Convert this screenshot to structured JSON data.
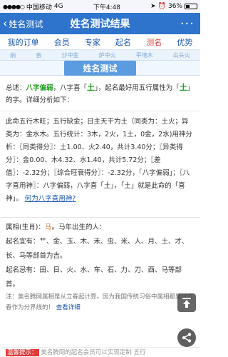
{
  "status": {
    "carrier": "中国移动",
    "network": "4G",
    "time": "下午4:48",
    "battery": "36%"
  },
  "nav": {
    "back_label": "姓名测试",
    "title": "姓名测试结果",
    "more_label": "···"
  },
  "tabs": [
    {
      "label": "我的订单"
    },
    {
      "label": "会员"
    },
    {
      "label": "专家"
    },
    {
      "label": "起名"
    },
    {
      "label": "测名"
    },
    {
      "label": "优势"
    }
  ],
  "wuxing_strip": [
    "纳",
    "音",
    "沙中金",
    "炉中火",
    "平地木",
    "山头火"
  ],
  "banner": "姓名测试",
  "summary": {
    "prefix": "总述：",
    "p1": "八字偏弱",
    "p2": "，八字喜「",
    "p3": "土",
    "p4": "」，起名最好用五行属性为「",
    "p5": "土",
    "p6": "」的字。详细分析如下："
  },
  "analysis": {
    "text": "此命五行木旺；五行缺金；日主天干为土（同类为：土火；异类为：金水木。五行统计：3木，2火，1土，0金，2水)用神分析：〖同类得分〗：土1.00、火2.40，共计3.40分；〖异类得分〗：金0.00、木4.32、水1.40，共计5.72分；〖差值〗：-2.32分；〖综合旺衰得分〗：-2.32分，「八字偏弱」；〖八字喜用神〗：八字偏弱，八字喜「土」，「土」就是此命的「喜神」。",
    "link": "何为八字喜用神?"
  },
  "zodiac": {
    "title_prefix": "属相(生肖)：",
    "animal": "马",
    "title_suffix": "。马年出生的人：",
    "good_label": "起名宜有：",
    "good": "艹、金、玉、木、禾、虫、米、人、月、土、才、长、马等部首为吉。",
    "bad_label": "起名忌有：",
    "bad": "田、日、火、水、车、石、力、刀、酉、马等部首。",
    "note": "注：美名腾网属相是从立春起计算。因为我国传统习俗中属相都是以立春作为分界线的！",
    "note_link": "查看详细"
  },
  "bottom": {
    "highlight": "温馨提示：",
    "text": "美名腾网的起名会员可以实现定制",
    "tail": "五行"
  }
}
